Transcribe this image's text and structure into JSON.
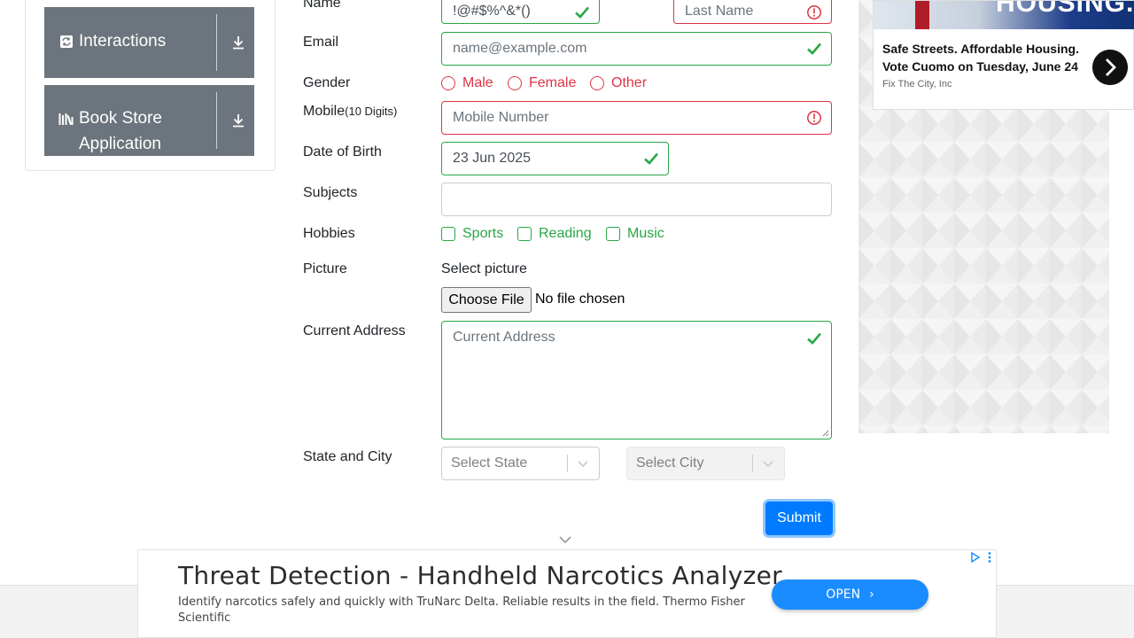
{
  "sidebar": {
    "groups": [
      {
        "label": "Interactions",
        "icon": "interactions-icon"
      },
      {
        "label": "Book Store Application",
        "label_line1": "Book Store",
        "label_line2": "Application",
        "icon": "book-icon"
      }
    ]
  },
  "form": {
    "name": {
      "label": "Name",
      "first_value": "!@#$%^&*()",
      "last_placeholder": "Last Name"
    },
    "email": {
      "label": "Email",
      "placeholder": "name@example.com"
    },
    "gender": {
      "label": "Gender",
      "options": [
        "Male",
        "Female",
        "Other"
      ]
    },
    "mobile": {
      "label": "Mobile",
      "hint": "(10 Digits)",
      "placeholder": "Mobile Number"
    },
    "dob": {
      "label": "Date of Birth",
      "value": "23 Jun 2025"
    },
    "subjects": {
      "label": "Subjects",
      "value": ""
    },
    "hobbies": {
      "label": "Hobbies",
      "options": [
        "Sports",
        "Reading",
        "Music"
      ]
    },
    "picture": {
      "label": "Picture",
      "prompt": "Select picture",
      "button": "Choose File",
      "status": "No file chosen"
    },
    "address": {
      "label": "Current Address",
      "placeholder": "Current Address"
    },
    "state_city": {
      "label": "State and City",
      "state_placeholder": "Select State",
      "city_placeholder": "Select City"
    },
    "submit": "Submit"
  },
  "ads": {
    "right": {
      "image_text": "HOUSING.",
      "headline": "Safe Streets. Affordable Housing. Vote Cuomo on Tuesday, June 24",
      "source": "Fix The City, Inc"
    },
    "bottom": {
      "title": "Threat Detection - Handheld Narcotics Analyzer",
      "description": "Identify narcotics safely and quickly with TruNarc Delta. Reliable results in the field. Thermo Fisher Scientific",
      "cta": "OPEN"
    }
  },
  "colors": {
    "valid": "#28a745",
    "invalid": "#dc3545",
    "primary": "#007bff",
    "sidebar_header": "#6c757d"
  }
}
